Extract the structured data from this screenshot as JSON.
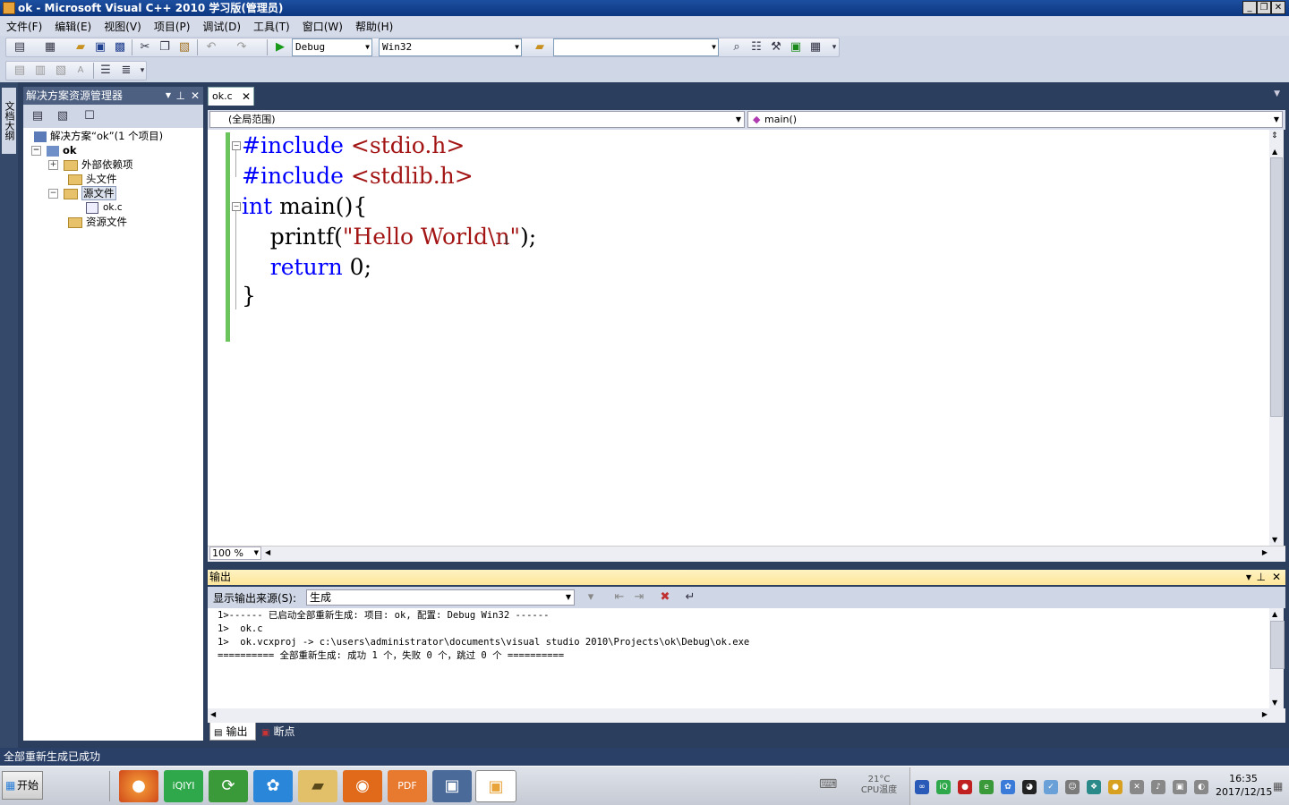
{
  "window": {
    "title": "ok - Microsoft Visual C++ 2010 学习版(管理员)"
  },
  "menu": [
    "文件(F)",
    "编辑(E)",
    "视图(V)",
    "项目(P)",
    "调试(D)",
    "工具(T)",
    "窗口(W)",
    "帮助(H)"
  ],
  "toolbar": {
    "config": "Debug",
    "platform": "Win32",
    "find": ""
  },
  "left_strip": {
    "label": "文档大纲"
  },
  "solution_explorer": {
    "title": "解决方案资源管理器",
    "solution": "解决方案“ok”(1 个项目)",
    "project": "ok",
    "items": [
      "外部依赖项",
      "头文件",
      "源文件",
      "ok.c",
      "资源文件"
    ]
  },
  "editor": {
    "tab": "ok.c",
    "scope": "(全局范围)",
    "function": "main()",
    "zoom": "100 %",
    "code": {
      "l1_pp": "#include",
      "l1_inc": " <stdio.h>",
      "l2_pp": "#include",
      "l2_inc": " <stdlib.h>",
      "l3_kw": "int",
      "l3_rest": " main(){",
      "l4_fn": "    printf(",
      "l4_str": "\"Hello World\\n\"",
      "l4_end": ");",
      "l5_kw": "    return",
      "l5_rest": " 0;",
      "l6": "}"
    }
  },
  "output": {
    "title": "输出",
    "source_label": "显示输出来源(S):",
    "source_value": "生成",
    "lines": [
      "1>------ 已启动全部重新生成: 项目: ok, 配置: Debug Win32 ------",
      "1>  ok.c",
      "1>  ok.vcxproj -> c:\\users\\administrator\\documents\\visual studio 2010\\Projects\\ok\\Debug\\ok.exe",
      "========== 全部重新生成: 成功 1 个，失败 0 个，跳过 0 个 =========="
    ],
    "tabs": [
      "输出",
      "断点"
    ]
  },
  "status": "全部重新生成已成功",
  "taskbar": {
    "start": "开始",
    "temp_value": "21°C",
    "temp_label": "CPU温度",
    "time": "16:35",
    "date": "2017/12/15"
  }
}
